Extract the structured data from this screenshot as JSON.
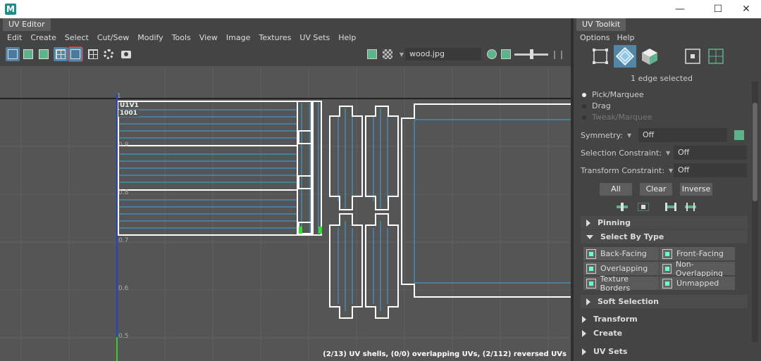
{
  "window": {
    "logo": "M",
    "minimize_glyph": "—",
    "maximize_glyph": "☐",
    "close_glyph": "✕"
  },
  "uv_editor": {
    "tab_label": "UV Editor",
    "menus": [
      "Edit",
      "Create",
      "Select",
      "Cut/Sew",
      "Modify",
      "Tools",
      "View",
      "Image",
      "Textures",
      "UV Sets",
      "Help"
    ],
    "texture_name": "wood.jpg",
    "tile_label_1": "U1V1",
    "tile_label_2": "1001",
    "axis_labels": [
      "1",
      "0.9",
      "0.8",
      "0.7",
      "0.6",
      "0.5"
    ],
    "status": "(2/13) UV shells, (0/0) overlapping UVs, (2/112) reversed UVs"
  },
  "toolkit": {
    "tab_label": "UV Toolkit",
    "menus": [
      "Options",
      "Help"
    ],
    "selection_info": "1 edge selected",
    "tools": [
      {
        "label": "Pick/Marquee",
        "selected": true
      },
      {
        "label": "Drag",
        "selected": false
      },
      {
        "label": "Tweak/Marquee",
        "selected": false
      }
    ],
    "symmetry": {
      "label": "Symmetry:",
      "value": "Off"
    },
    "selection_constraint": {
      "label": "Selection Constraint:",
      "value": "Off"
    },
    "transform_constraint": {
      "label": "Transform Constraint:",
      "value": "Off"
    },
    "buttons": {
      "all": "All",
      "clear": "Clear",
      "inverse": "Inverse"
    },
    "sections": {
      "pinning": "Pinning",
      "select_by_type": "Select By Type",
      "soft_selection": "Soft Selection",
      "transform": "Transform",
      "create": "Create",
      "uv_sets": "UV Sets"
    },
    "type_buttons": [
      "Back-Facing",
      "Front-Facing",
      "Overlapping",
      "Non-Overlapping",
      "Texture Borders",
      "Unmapped"
    ],
    "colors": {
      "accent": "#5285a6",
      "uv_blue": "#3aa7e0",
      "highlight_green": "#33dd33"
    }
  }
}
